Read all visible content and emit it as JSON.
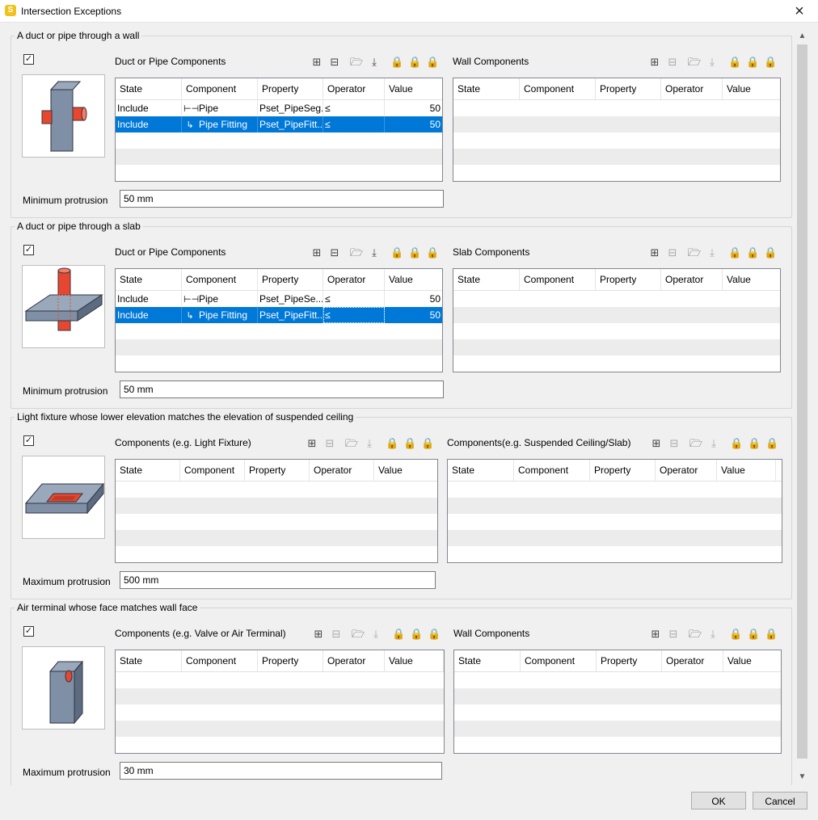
{
  "window": {
    "title": "Intersection Exceptions",
    "app_icon_letter": "S",
    "close_glyph": "×"
  },
  "checkbox_glyph": "✓",
  "toolbar_icons": {
    "add": "add-row-icon",
    "remove": "remove-row-icon",
    "open": "open-folder-icon",
    "import": "import-icon",
    "lock": "lock-icon"
  },
  "columns": [
    "State",
    "Component",
    "Property",
    "Operator",
    "Value"
  ],
  "sections": [
    {
      "title": "A duct or pipe through a wall",
      "checked": true,
      "left_panel": {
        "title": "Duct or Pipe Components",
        "rows": [
          {
            "state": "Include",
            "component": "Pipe",
            "component_icon": "pipe-icon",
            "property": "Pset_PipeSeg...",
            "operator": "≤",
            "value": "50"
          },
          {
            "state": "Include",
            "component": "Pipe Fitting",
            "component_icon": "pipe-fitting-icon",
            "property": "Pset_PipeFitt...",
            "operator": "≤",
            "value": "50",
            "selected": true
          }
        ]
      },
      "right_panel": {
        "title": "Wall Components",
        "rows": []
      },
      "field": {
        "label": "Minimum protrusion",
        "value": "50 mm"
      }
    },
    {
      "title": "A duct or pipe through a slab",
      "checked": true,
      "left_panel": {
        "title": "Duct or Pipe Components",
        "rows": [
          {
            "state": "Include",
            "component": "Pipe",
            "component_icon": "pipe-icon",
            "property": "Pset_PipeSe...",
            "operator": "≤",
            "value": "50"
          },
          {
            "state": "Include",
            "component": "Pipe Fitting",
            "component_icon": "pipe-fitting-icon",
            "property": "Pset_PipeFitt...",
            "operator": "≤",
            "value": "50",
            "selected": true
          }
        ]
      },
      "right_panel": {
        "title": "Slab Components",
        "rows": []
      },
      "field": {
        "label": "Minimum protrusion",
        "value": "50 mm"
      }
    },
    {
      "title": "Light fixture whose lower elevation matches the elevation of suspended ceiling",
      "checked": true,
      "left_panel": {
        "title": "Components (e.g. Light Fixture)",
        "rows": []
      },
      "right_panel": {
        "title": "Components(e.g. Suspended Ceiling/Slab)",
        "rows": []
      },
      "field": {
        "label": "Maximum protrusion",
        "value": "500 mm"
      }
    },
    {
      "title": "Air terminal whose face matches wall face",
      "checked": true,
      "left_panel": {
        "title": "Components (e.g. Valve or Air Terminal)",
        "rows": []
      },
      "right_panel": {
        "title": "Wall Components",
        "rows": []
      },
      "field": {
        "label": "Maximum protrusion",
        "value": "30 mm"
      }
    }
  ],
  "buttons": {
    "ok": "OK",
    "cancel": "Cancel"
  },
  "colors": {
    "selection": "#0078d7",
    "pipe": "#e8472f",
    "wall": "#7f8fa6",
    "window_bg": "#f0f0f0"
  }
}
